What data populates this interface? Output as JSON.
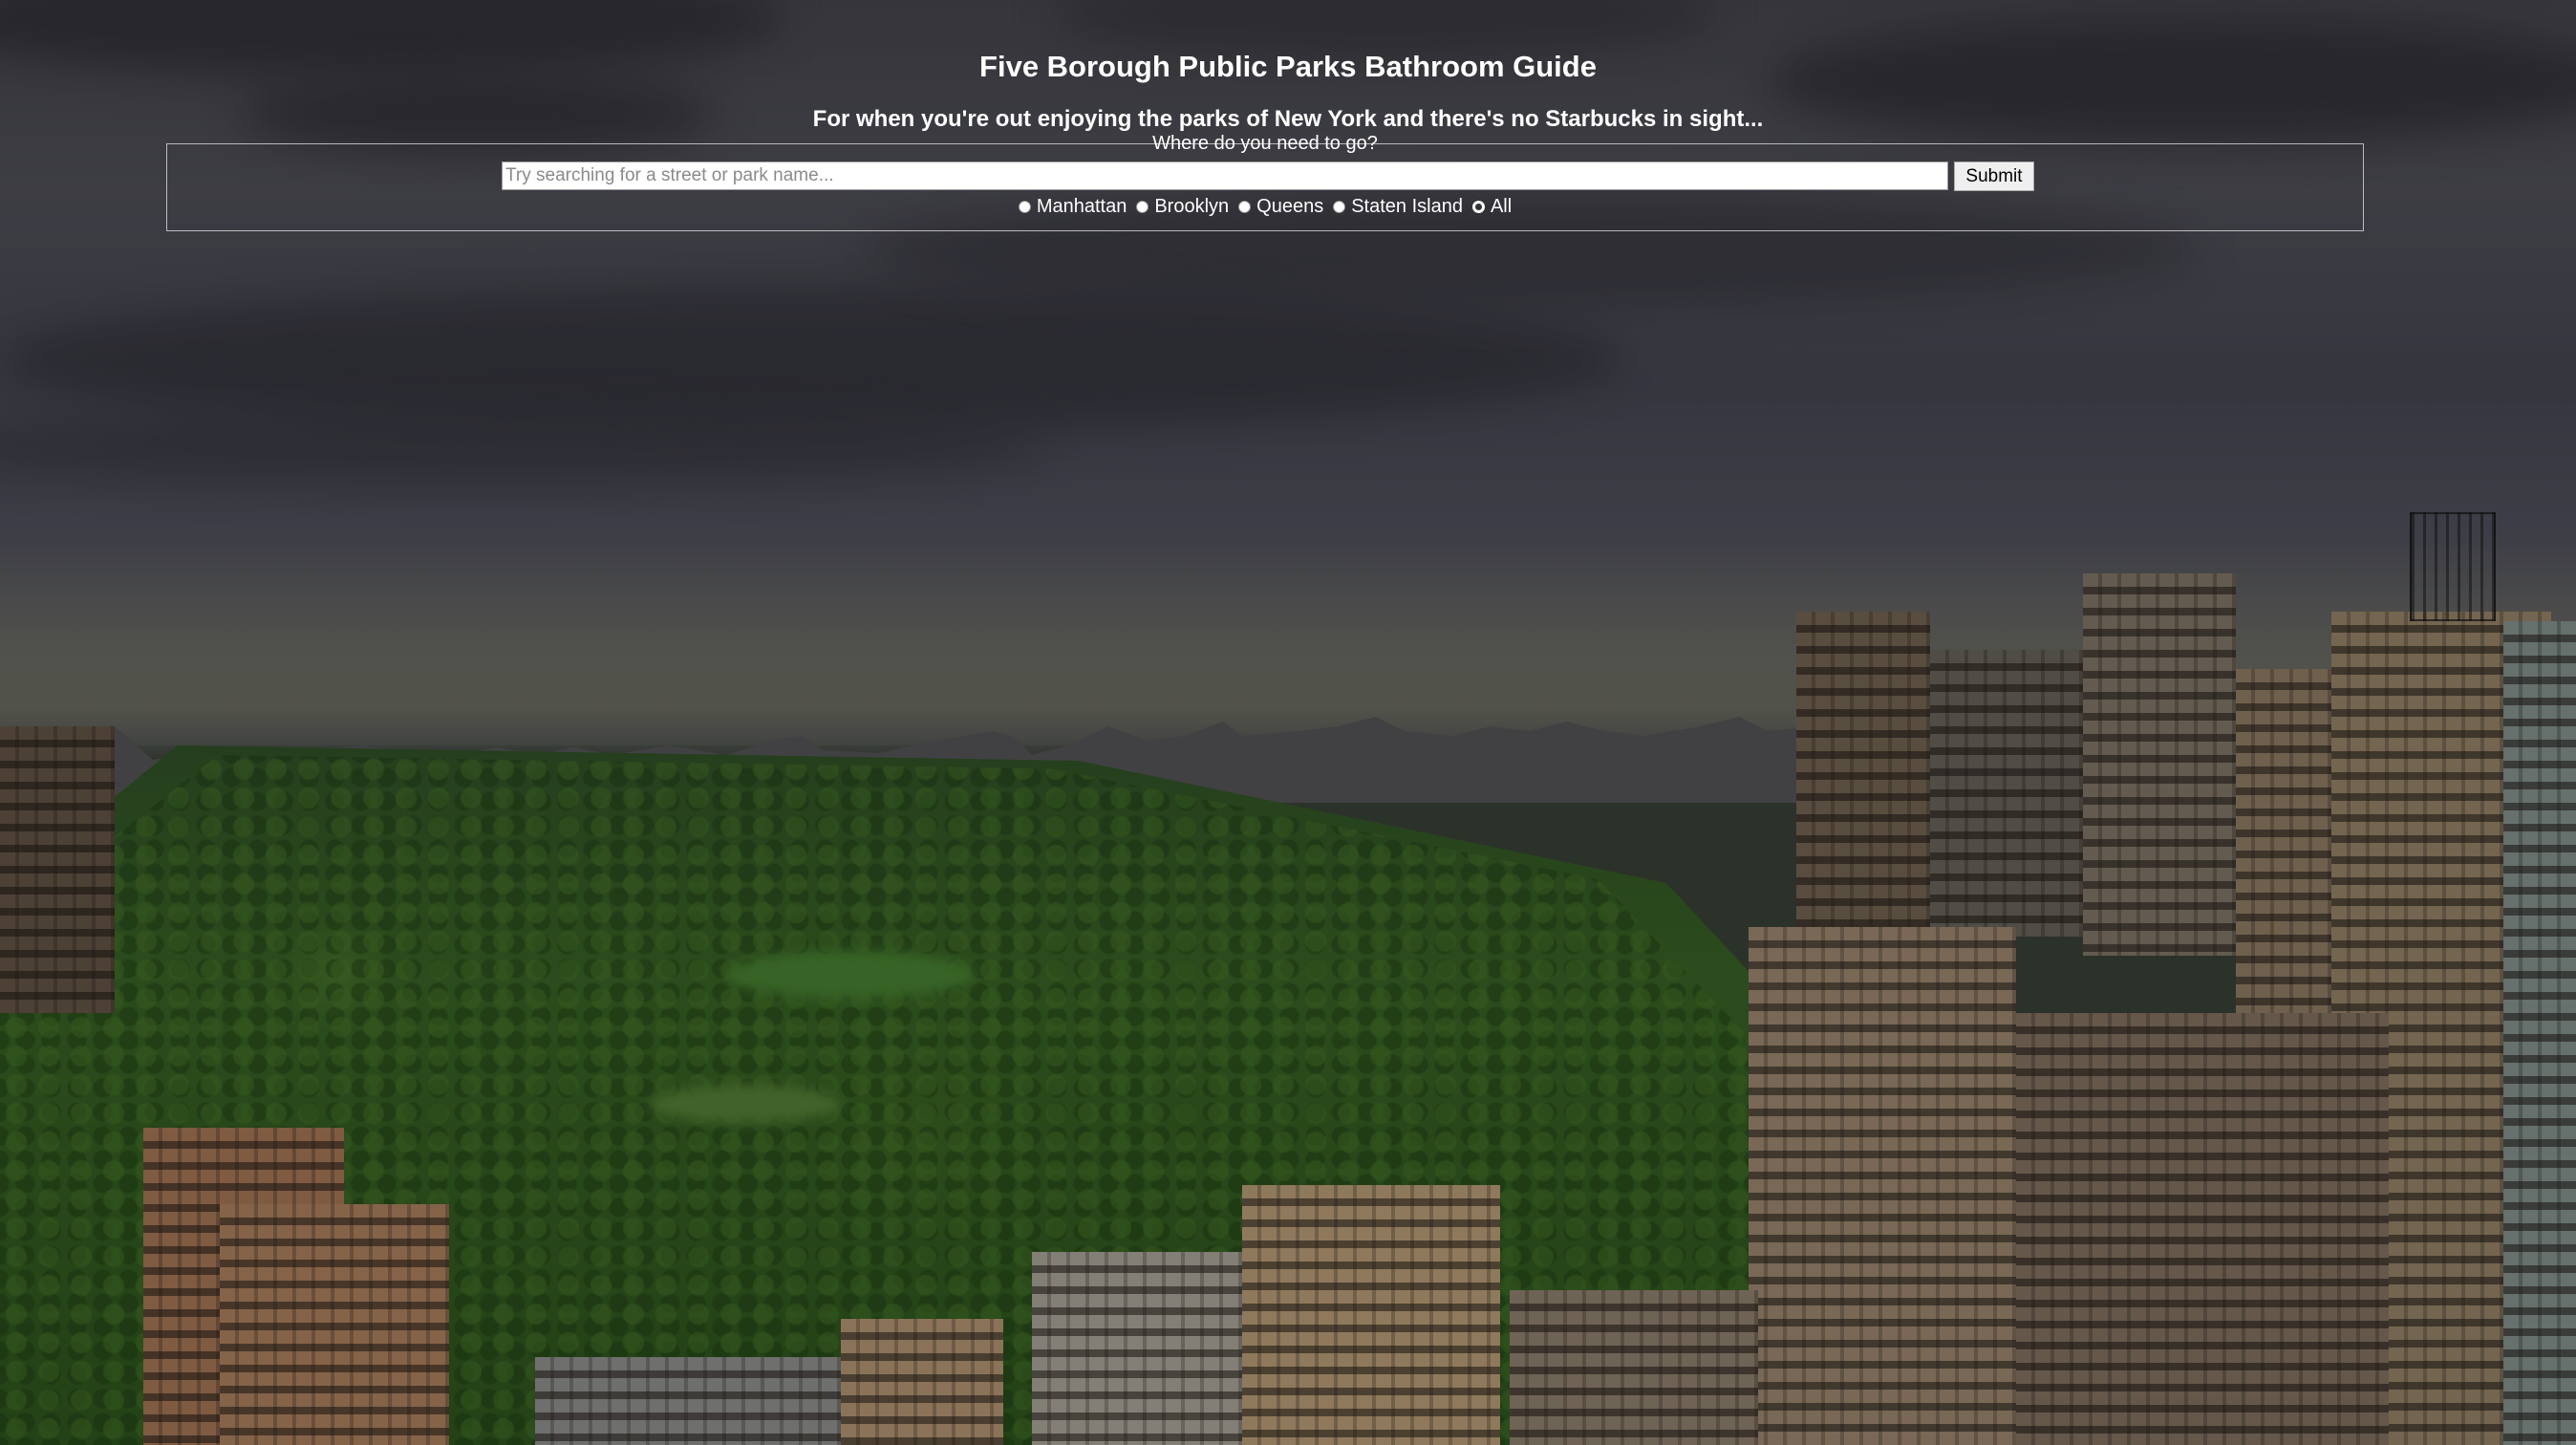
{
  "header": {
    "title": "Five Borough Public Parks Bathroom Guide",
    "tagline": "For when you're out enjoying the parks of New York and there's no Starbucks in sight..."
  },
  "search": {
    "legend": "Where do you need to go?",
    "placeholder": "Try searching for a street or park name...",
    "value": "",
    "submit_label": "Submit"
  },
  "boroughs": {
    "options": [
      {
        "label": "Manhattan",
        "checked": false
      },
      {
        "label": "Brooklyn",
        "checked": false
      },
      {
        "label": "Queens",
        "checked": false
      },
      {
        "label": "Staten Island",
        "checked": false
      },
      {
        "label": "All",
        "checked": true
      }
    ]
  },
  "background": {
    "description_icon": "central-park-skyline-photo"
  }
}
